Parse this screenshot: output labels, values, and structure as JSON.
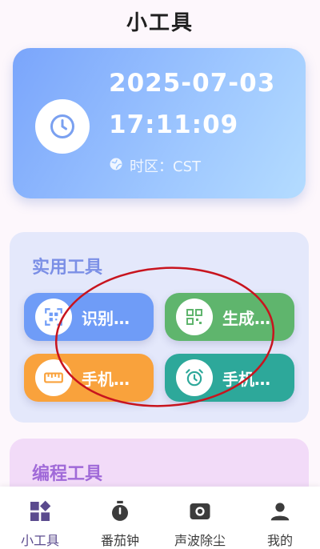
{
  "header": {
    "title": "小工具"
  },
  "clock": {
    "date": "2025-07-03",
    "time": "17:11:09",
    "timezone": "时区：CST",
    "icon": "clock-icon"
  },
  "tools_section": {
    "title": "实用工具",
    "buttons": [
      {
        "label": "识别…",
        "icon": "qr-scan-icon",
        "color": "#6f9cf7"
      },
      {
        "label": "生成…",
        "icon": "qr-code-icon",
        "color": "#5fb56d"
      },
      {
        "label": "手机…",
        "icon": "ruler-icon",
        "color": "#f9a23c"
      },
      {
        "label": "手机…",
        "icon": "alarm-clock-icon",
        "color": "#2da89a"
      }
    ]
  },
  "programming_section": {
    "title": "编程工具"
  },
  "bottom_nav": {
    "items": [
      {
        "label": "小工具",
        "icon": "widgets-icon",
        "active": true
      },
      {
        "label": "番茄钟",
        "icon": "stopwatch-icon",
        "active": false
      },
      {
        "label": "声波除尘",
        "icon": "speaker-icon",
        "active": false
      },
      {
        "label": "我的",
        "icon": "person-icon",
        "active": false
      }
    ]
  },
  "colors": {
    "accent": "#5b4b8e",
    "annotation": "#c8141e"
  }
}
